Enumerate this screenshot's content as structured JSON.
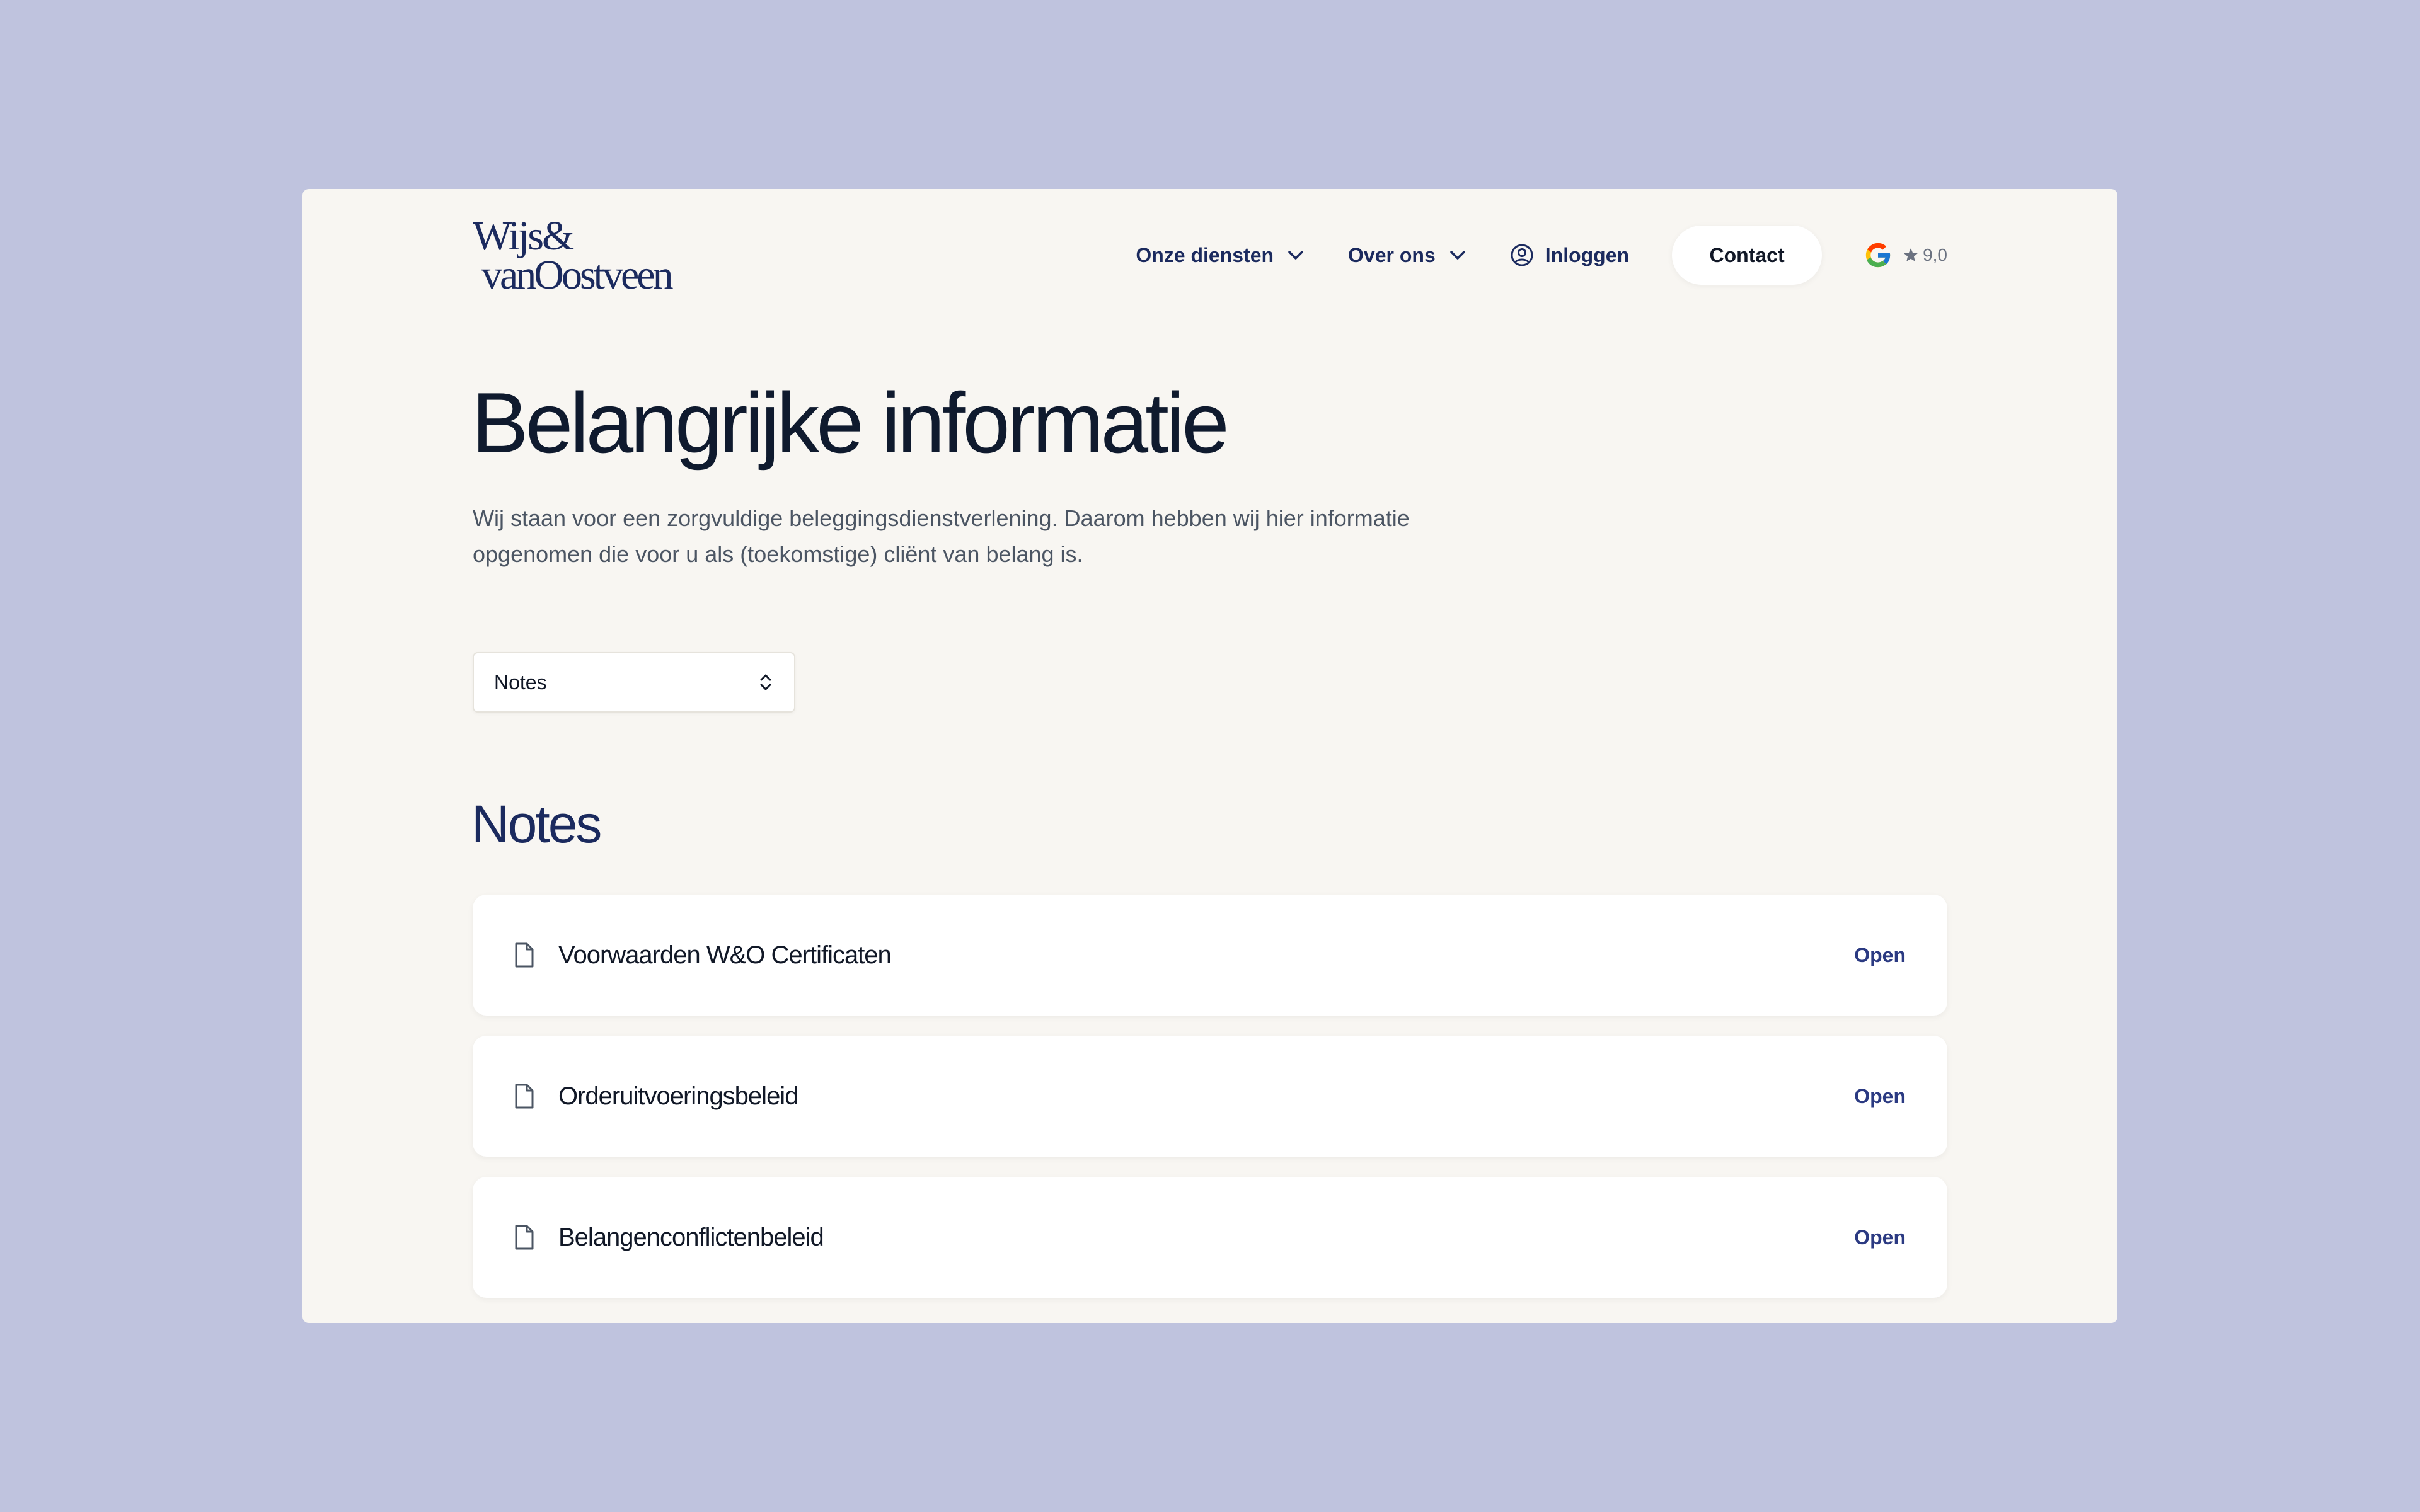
{
  "brand": {
    "logo_line1": "Wijs&",
    "logo_line2": "vanOostveen",
    "color": "#1b2a5e"
  },
  "nav": {
    "services_label": "Onze diensten",
    "about_label": "Over ons",
    "login_label": "Inloggen",
    "contact_label": "Contact",
    "rating": "9,0",
    "icons": [
      "chevron-down-icon",
      "user-circle-icon",
      "google-icon",
      "star-icon"
    ]
  },
  "page": {
    "title": "Belangrijke informatie",
    "intro": "Wij staan voor een zorgvuldige beleggingsdienstverlening. Daarom hebben wij hier informatie opgenomen die voor u als (toekomstige) cliënt van belang is."
  },
  "filter": {
    "selected": "Notes"
  },
  "section": {
    "title": "Notes",
    "documents": [
      {
        "title": "Voorwaarden W&O Certificaten",
        "action": "Open"
      },
      {
        "title": "Orderuitvoeringsbeleid",
        "action": "Open"
      },
      {
        "title": "Belangenconflictenbeleid",
        "action": "Open"
      }
    ]
  },
  "colors": {
    "backdrop": "#bfc3de",
    "page_bg": "#f8f6f2",
    "navy": "#1b2a5e",
    "link": "#2b3a82",
    "text_muted": "#4b5563"
  }
}
